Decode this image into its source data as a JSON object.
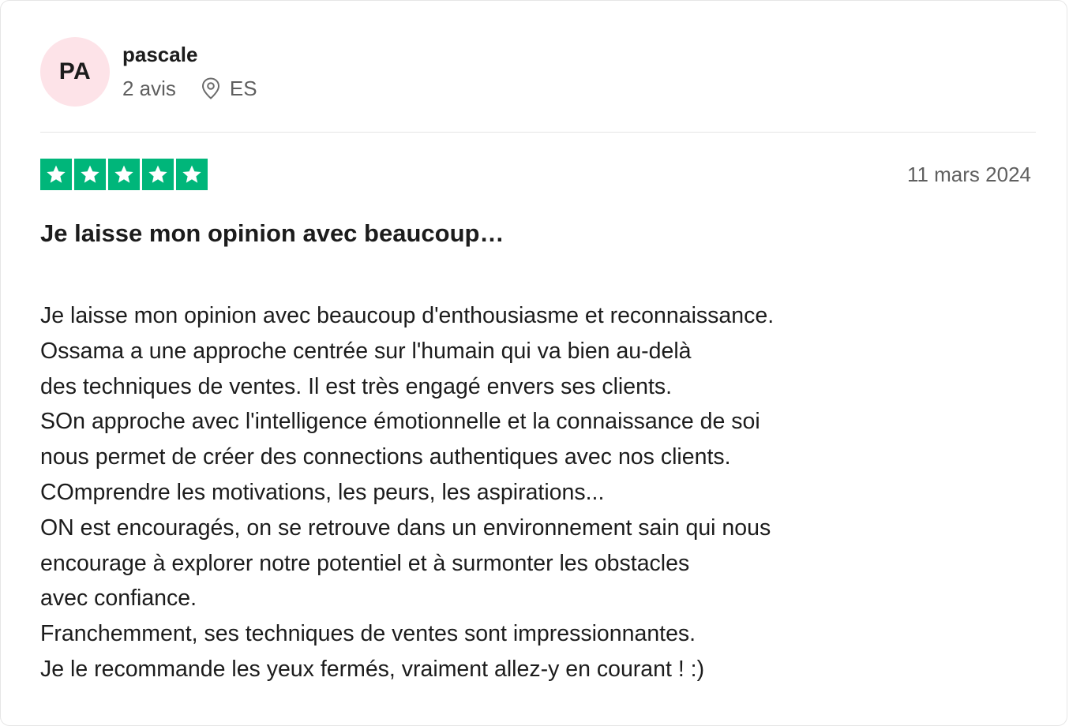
{
  "reviewer": {
    "initials": "PA",
    "name": "pascale",
    "review_count": "2 avis",
    "country": "ES"
  },
  "rating": {
    "stars": 5,
    "max": 5,
    "color": "#00b67a"
  },
  "date": "11 mars 2024",
  "title": "Je laisse mon opinion avec beaucoup…",
  "body_lines": [
    "Je laisse mon opinion avec beaucoup d'enthousiasme et reconnaissance.",
    "Ossama a une approche centrée sur l'humain qui va bien au-delà",
    "des techniques de ventes. Il est très engagé envers ses clients.",
    "SOn approche avec l'intelligence émotionnelle et la connaissance de soi",
    "nous permet de créer des connections authentiques avec nos clients.",
    "COmprendre les motivations, les peurs, les aspirations...",
    "ON est encouragés, on se retrouve dans un environnement sain qui nous",
    "encourage à explorer notre potentiel et à surmonter les obstacles",
    "avec confiance.",
    "Franchemment, ses techniques de ventes sont impressionnantes.",
    "Je le recommande les yeux fermés, vraiment allez-y en courant ! :)"
  ],
  "icons": {
    "location": "location-pin-icon",
    "star": "star-icon"
  }
}
